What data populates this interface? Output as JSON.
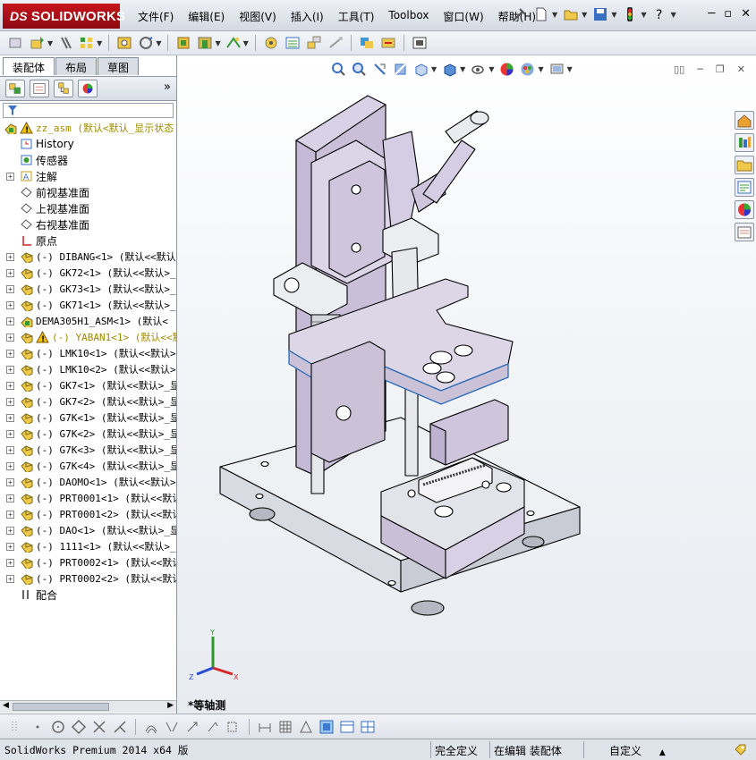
{
  "app": {
    "name": "SOLIDWORKS",
    "logo_mark": "DS"
  },
  "menu": [
    "文件(F)",
    "编辑(E)",
    "视图(V)",
    "插入(I)",
    "工具(T)",
    "Toolbox",
    "窗口(W)",
    "帮助(H)"
  ],
  "left_panel": {
    "tabs": [
      "装配体",
      "布局",
      "草图"
    ],
    "active_tab": "装配体",
    "more_glyph": "»"
  },
  "tree": [
    {
      "text": "zz_asm  (默认<默认_显示状态",
      "warn": true,
      "icon": "assembly-icon",
      "expand": false,
      "indent": 0
    },
    {
      "text": "History",
      "icon": "history-icon",
      "expand": false,
      "indent": 1
    },
    {
      "text": "传感器",
      "icon": "sensor-icon",
      "expand": false,
      "indent": 1
    },
    {
      "text": "注解",
      "icon": "annotation-icon",
      "expand": true,
      "indent": 1
    },
    {
      "text": "前视基准面",
      "icon": "plane-icon",
      "expand": false,
      "indent": 1
    },
    {
      "text": "上视基准面",
      "icon": "plane-icon",
      "expand": false,
      "indent": 1
    },
    {
      "text": "右视基准面",
      "icon": "plane-icon",
      "expand": false,
      "indent": 1
    },
    {
      "text": "原点",
      "icon": "origin-icon",
      "expand": false,
      "indent": 1
    },
    {
      "text": "(-) DIBANG<1> (默认<<默认>",
      "icon": "part-icon",
      "expand": true,
      "indent": 1
    },
    {
      "text": "(-) GK72<1> (默认<<默认>_显",
      "icon": "part-icon",
      "expand": true,
      "indent": 1
    },
    {
      "text": "(-) GK73<1> (默认<<默认>_显",
      "icon": "part-icon",
      "expand": true,
      "indent": 1
    },
    {
      "text": "(-) GK71<1> (默认<<默认>_显",
      "icon": "part-icon",
      "expand": true,
      "indent": 1
    },
    {
      "text": "DEMA305H1_ASM<1> (默认<",
      "icon": "subassembly-icon",
      "expand": true,
      "indent": 1
    },
    {
      "text": "(-) YABAN1<1> (默认<<默",
      "warn": true,
      "icon": "part-icon",
      "expand": true,
      "indent": 1
    },
    {
      "text": "(-) LMK10<1> (默认<<默认>",
      "icon": "part-icon",
      "expand": true,
      "indent": 1
    },
    {
      "text": "(-) LMK10<2> (默认<<默认>",
      "icon": "part-icon",
      "expand": true,
      "indent": 1
    },
    {
      "text": "(-) GK7<1> (默认<<默认>_显",
      "icon": "part-icon",
      "expand": true,
      "indent": 1
    },
    {
      "text": "(-) GK7<2> (默认<<默认>_显",
      "icon": "part-icon",
      "expand": true,
      "indent": 1
    },
    {
      "text": "(-) G7K<1> (默认<<默认>_显",
      "icon": "part-icon",
      "expand": true,
      "indent": 1
    },
    {
      "text": "(-) G7K<2> (默认<<默认>_显",
      "icon": "part-icon",
      "expand": true,
      "indent": 1
    },
    {
      "text": "(-) G7K<3> (默认<<默认>_显",
      "icon": "part-icon",
      "expand": true,
      "indent": 1
    },
    {
      "text": "(-) G7K<4> (默认<<默认>_显",
      "icon": "part-icon",
      "expand": true,
      "indent": 1
    },
    {
      "text": "(-) DAOMO<1> (默认<<默认>",
      "icon": "part-icon",
      "expand": true,
      "indent": 1
    },
    {
      "text": "(-) PRT0001<1> (默认<<默认",
      "icon": "part-icon",
      "expand": true,
      "indent": 1
    },
    {
      "text": "(-) PRT0001<2> (默认<<默认",
      "icon": "part-icon",
      "expand": true,
      "indent": 1
    },
    {
      "text": "(-) DAO<1> (默认<<默认>_显",
      "icon": "part-icon",
      "expand": true,
      "indent": 1
    },
    {
      "text": "(-) 1111<1> (默认<<默认>_显",
      "icon": "part-icon",
      "expand": true,
      "indent": 1
    },
    {
      "text": "(-) PRT0002<1> (默认<<默认",
      "icon": "part-icon",
      "expand": true,
      "indent": 1
    },
    {
      "text": "(-) PRT0002<2> (默认<<默认",
      "icon": "part-icon",
      "expand": true,
      "indent": 1
    },
    {
      "text": "配合",
      "icon": "mates-icon",
      "expand": false,
      "indent": 1
    }
  ],
  "viewport": {
    "view_name": "*等轴测",
    "triad": {
      "x": "X",
      "y": "Y",
      "z": "Z"
    }
  },
  "status": {
    "version": "SolidWorks Premium 2014 x64 版",
    "definition": "完全定义",
    "mode": "在编辑 装配体",
    "units": "自定义",
    "units_arrow": "▲"
  },
  "colors": {
    "brand_red": "#c8141c",
    "part_fill": "#c9bfd6",
    "base_fill": "#eceef2",
    "warn": "#f2c200"
  }
}
